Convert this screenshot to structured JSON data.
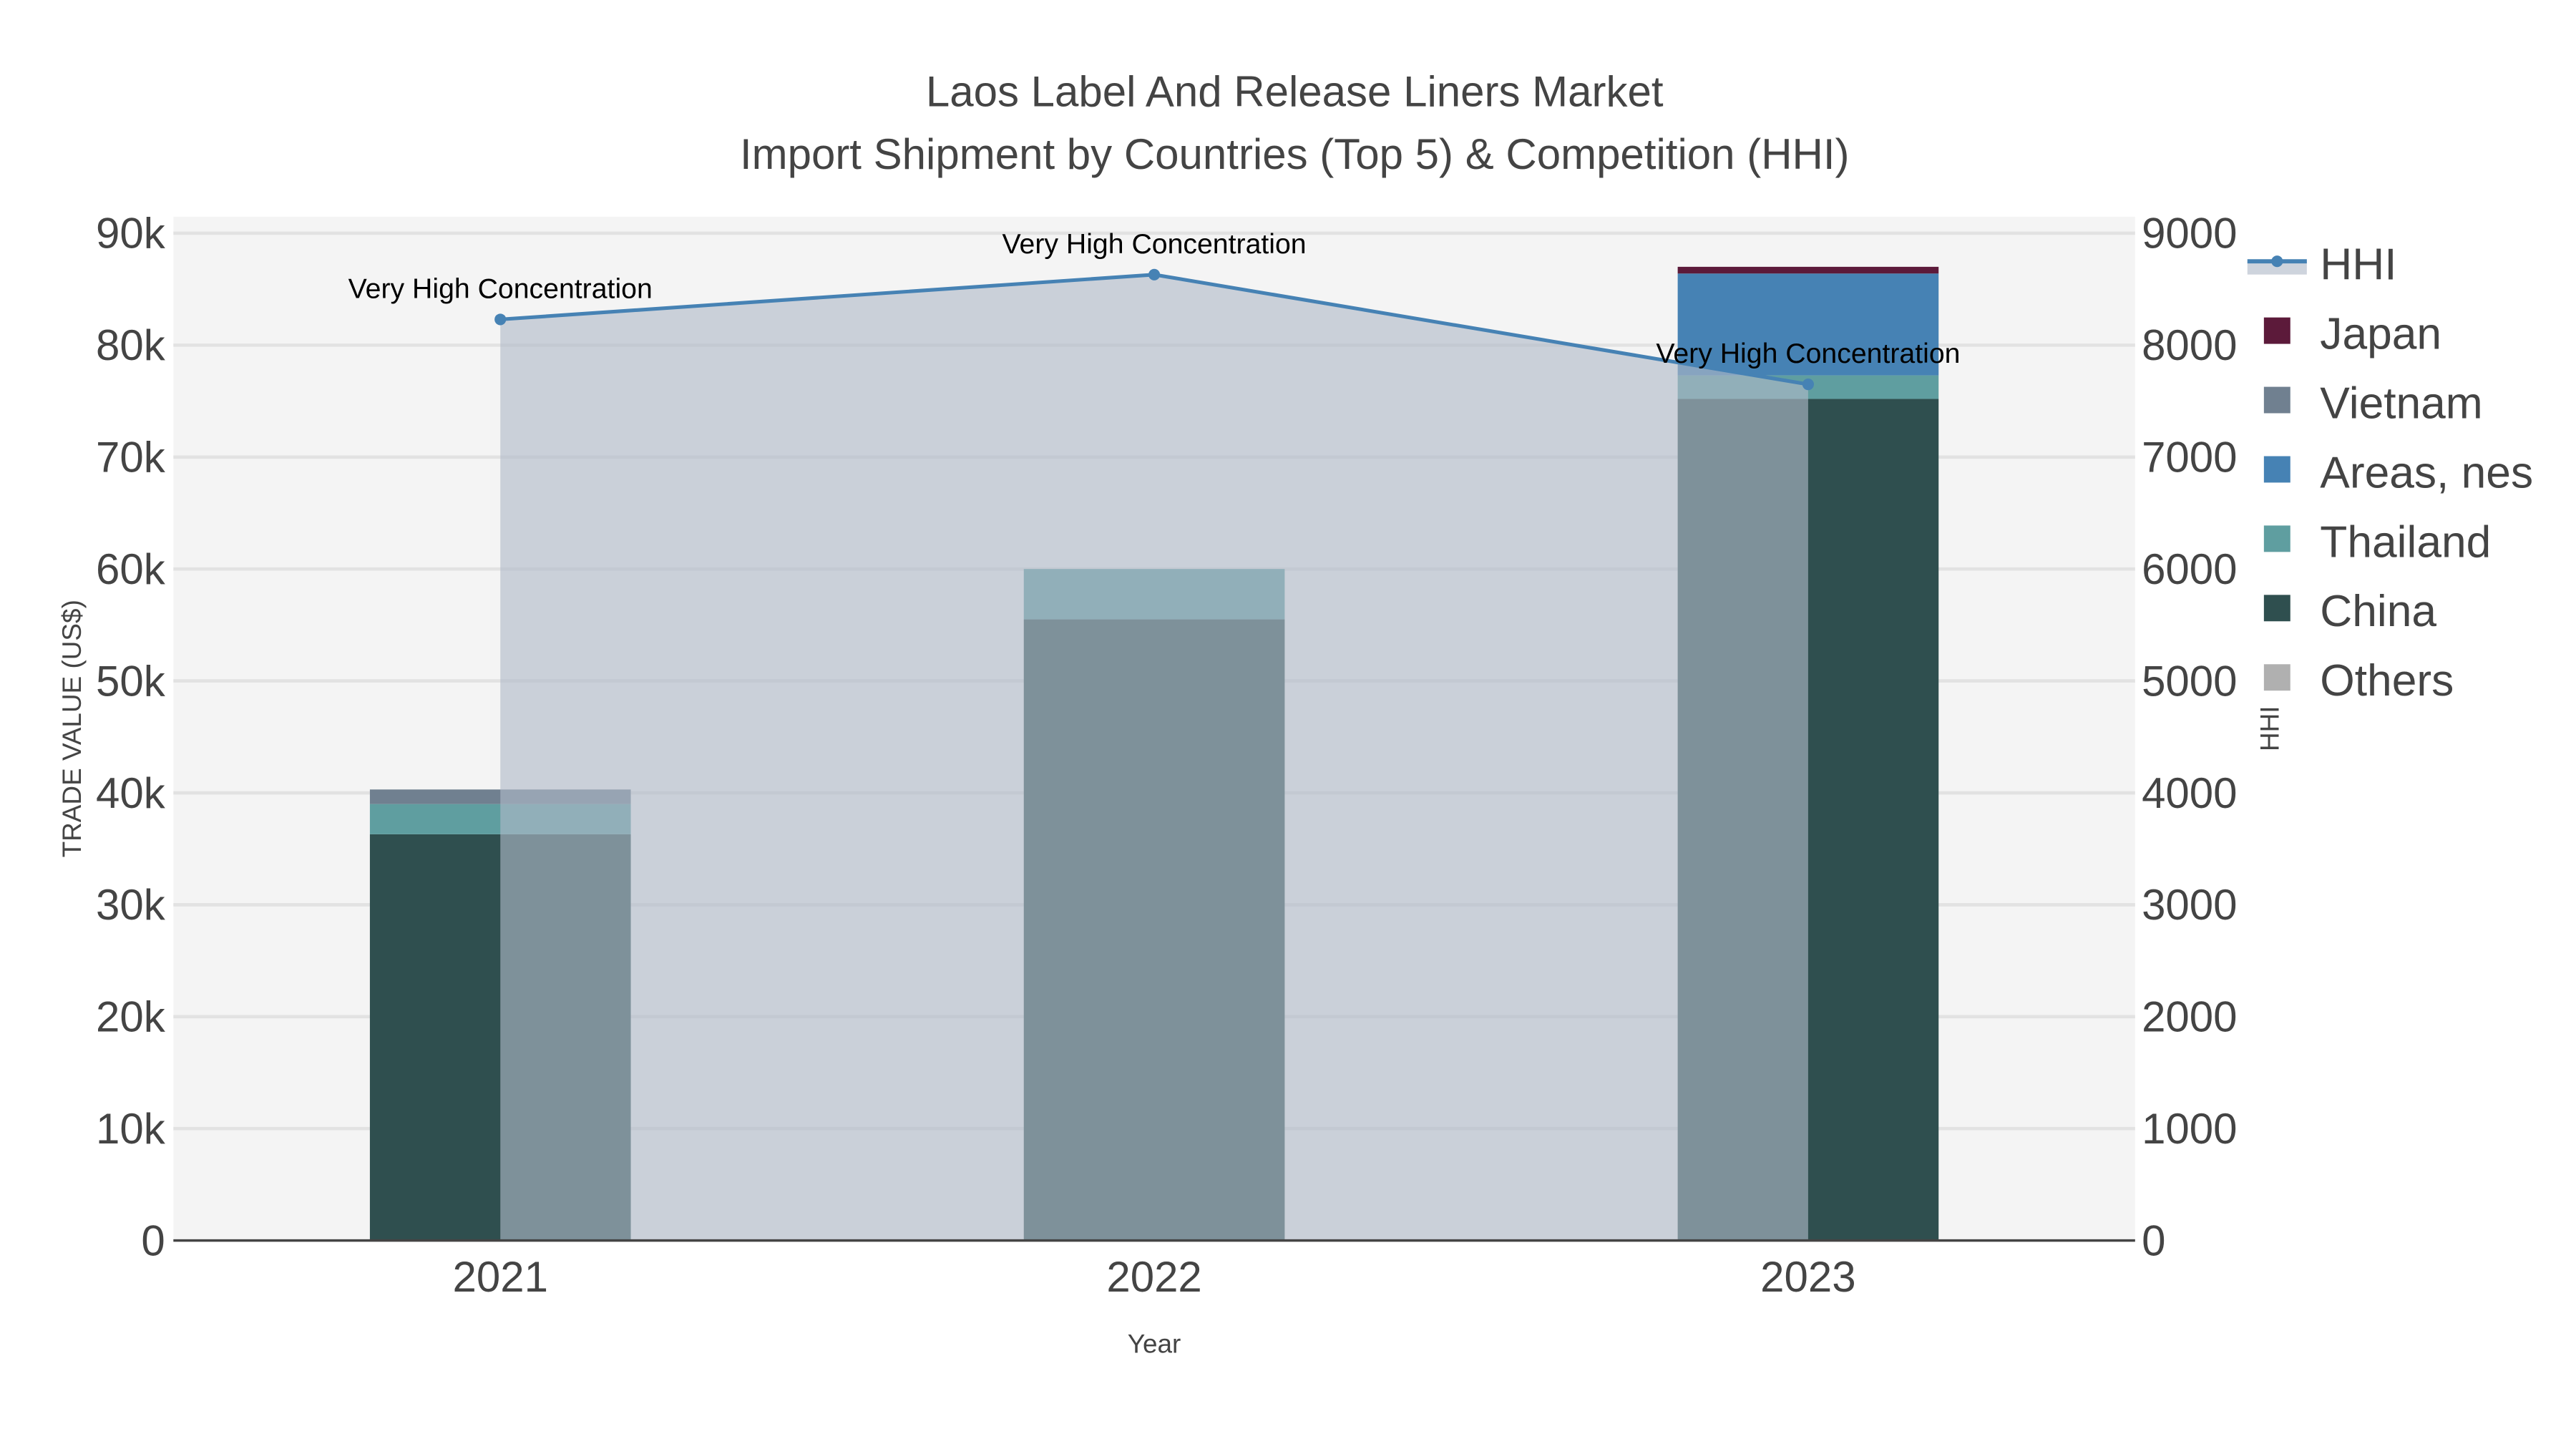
{
  "chart_data": {
    "type": "bar",
    "title_line1": "Laos Label And Release Liners Market",
    "title_line2": "Import Shipment by Countries (Top 5) & Competition (HHI)",
    "xlabel": "Year",
    "ylabel": "TRADE VALUE (US$)",
    "y2label": "HHI",
    "categories": [
      "2021",
      "2022",
      "2023"
    ],
    "ylim": [
      0,
      90000
    ],
    "y2lim": [
      0,
      9000
    ],
    "yticks": [
      "0",
      "10k",
      "20k",
      "30k",
      "40k",
      "50k",
      "60k",
      "70k",
      "80k",
      "90k"
    ],
    "y2ticks": [
      "0",
      "1000",
      "2000",
      "3000",
      "4000",
      "5000",
      "6000",
      "7000",
      "8000",
      "9000"
    ],
    "grid": true,
    "legend_position": "right",
    "stacked_series": [
      {
        "name": "China",
        "color": "#2f4f4f",
        "values": [
          36300,
          55500,
          75200
        ]
      },
      {
        "name": "Thailand",
        "color": "#5f9ea0",
        "values": [
          2700,
          4500,
          2100
        ]
      },
      {
        "name": "Areas, nes",
        "color": "#4682b4",
        "values": [
          0,
          0,
          9100
        ]
      },
      {
        "name": "Vietnam",
        "color": "#708090",
        "values": [
          1300,
          0,
          0
        ]
      },
      {
        "name": "Japan",
        "color": "#5c1a3a",
        "values": [
          0,
          0,
          600
        ]
      },
      {
        "name": "Others",
        "color": "#b0b0b0",
        "values": [
          0,
          0,
          0
        ]
      }
    ],
    "hhi": {
      "name": "HHI",
      "color": "#4682b4",
      "values": [
        8230,
        8630,
        7650
      ],
      "annotations": [
        "Very High Concentration",
        "Very High Concentration",
        "Very High Concentration"
      ]
    },
    "legend": [
      "HHI",
      "Japan",
      "Vietnam",
      "Areas, nes",
      "Thailand",
      "China",
      "Others"
    ]
  }
}
